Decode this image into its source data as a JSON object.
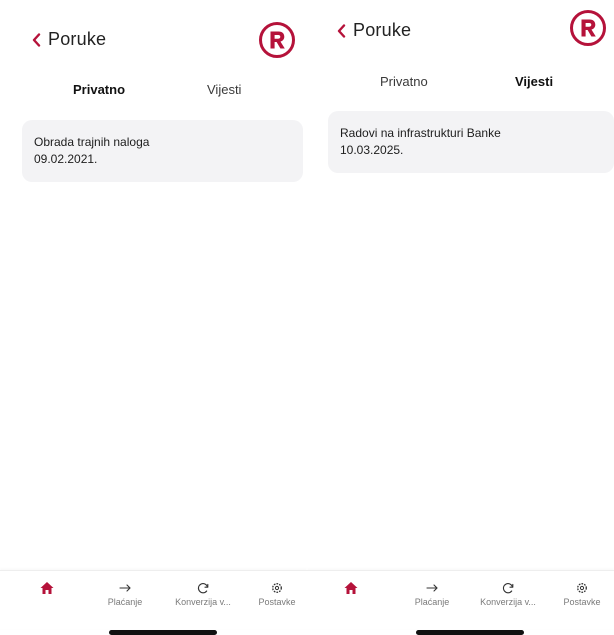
{
  "colors": {
    "brand": "#b5123a",
    "card_bg": "#f3f3f5",
    "text": "#1c1c1c",
    "nav_label": "#7a7a7a"
  },
  "screens": [
    {
      "header": {
        "back_icon": "chevron-left-icon",
        "title": "Poruke",
        "logo_icon": "r-logo-icon"
      },
      "tabs": [
        {
          "label": "Privatno",
          "active": true
        },
        {
          "label": "Vijesti",
          "active": false
        }
      ],
      "messages": [
        {
          "title": "Obrada trajnih naloga",
          "date": "09.02.2021."
        }
      ],
      "bottom_nav": [
        {
          "icon": "home-icon",
          "label": ""
        },
        {
          "icon": "arrow-right-icon",
          "label": "Plaćanje"
        },
        {
          "icon": "refresh-icon",
          "label": "Konverzija v..."
        },
        {
          "icon": "gear-icon",
          "label": "Postavke"
        }
      ]
    },
    {
      "header": {
        "back_icon": "chevron-left-icon",
        "title": "Poruke",
        "logo_icon": "r-logo-icon"
      },
      "tabs": [
        {
          "label": "Privatno",
          "active": false
        },
        {
          "label": "Vijesti",
          "active": true
        }
      ],
      "messages": [
        {
          "title": "Radovi na infrastrukturi Banke",
          "date": "10.03.2025."
        }
      ],
      "bottom_nav": [
        {
          "icon": "home-icon",
          "label": ""
        },
        {
          "icon": "arrow-right-icon",
          "label": "Plaćanje"
        },
        {
          "icon": "refresh-icon",
          "label": "Konverzija v..."
        },
        {
          "icon": "gear-icon",
          "label": "Postavke"
        }
      ]
    }
  ]
}
